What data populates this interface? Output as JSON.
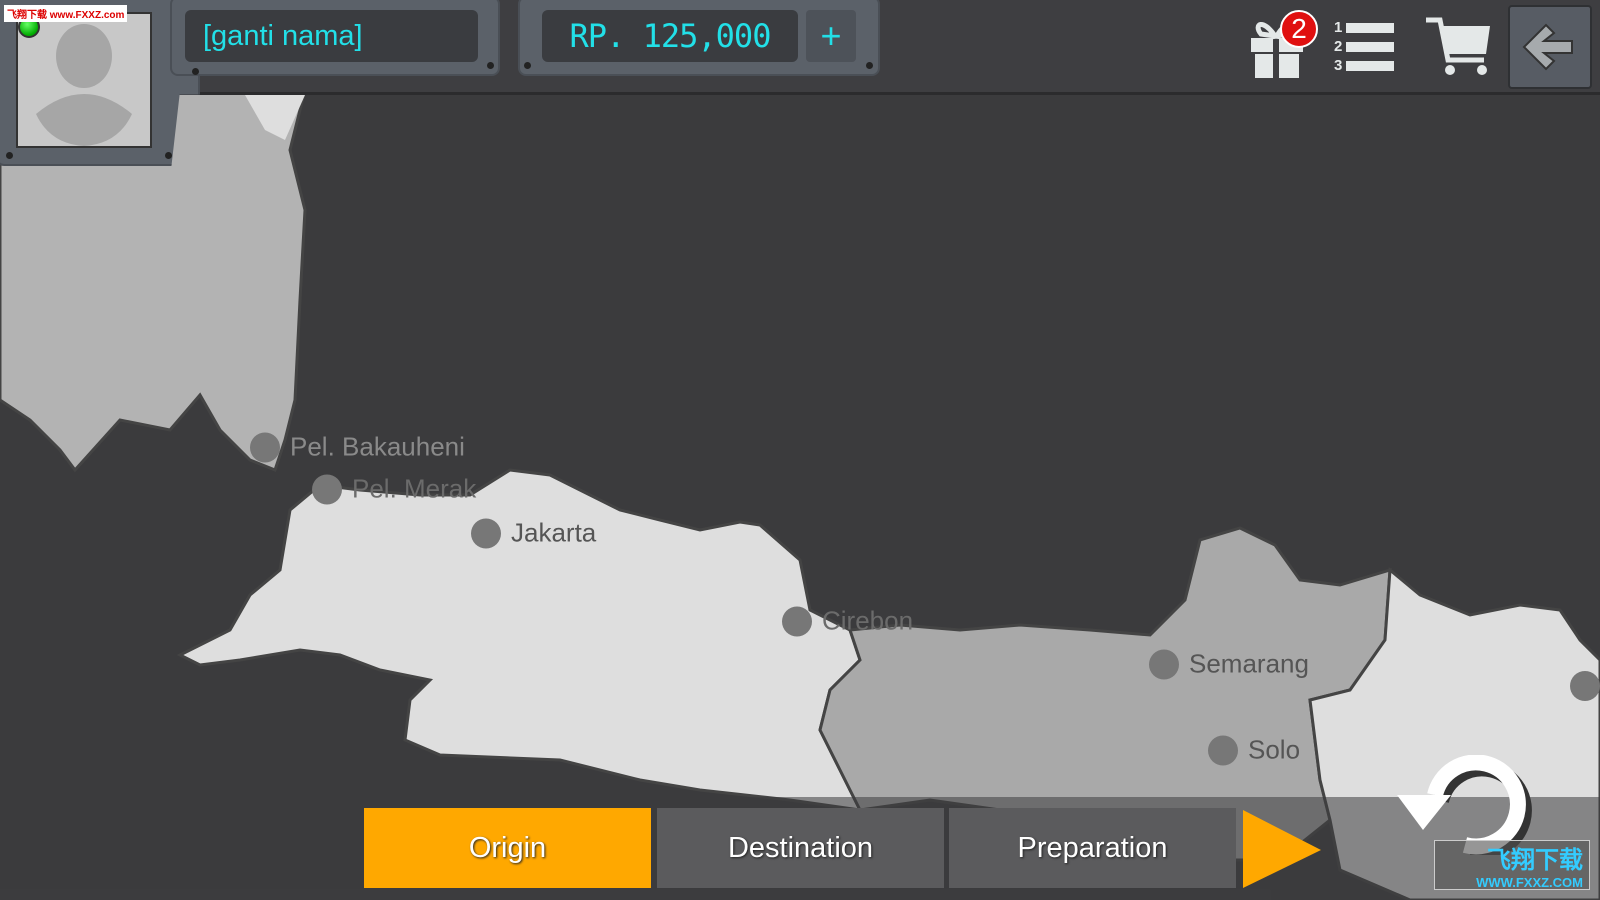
{
  "header": {
    "player_name": "[ganti nama]",
    "money": "RP. 125,000",
    "add_money_label": "+",
    "gift_badge_count": "2",
    "online_status_color": "#00cc00",
    "icons": [
      "gift-icon",
      "leaderboard-list-icon",
      "shopping-cart-icon",
      "back-arrow-icon"
    ],
    "list_numbers": [
      "1",
      "2",
      "3"
    ]
  },
  "map": {
    "cities": [
      {
        "name": "Pel. Bakauheni"
      },
      {
        "name": "Pel. Merak"
      },
      {
        "name": "Jakarta"
      },
      {
        "name": "Cirebon"
      },
      {
        "name": "Semarang"
      },
      {
        "name": "Solo"
      },
      {
        "name": ""
      }
    ]
  },
  "tabs": [
    {
      "label": "Origin",
      "active": true
    },
    {
      "label": "Destination",
      "active": false
    },
    {
      "label": "Preparation",
      "active": false
    }
  ],
  "colors": {
    "accent": "#ffa800",
    "lcd_text": "#22e0e8",
    "badge": "#e01010"
  },
  "watermarks": {
    "top_left": "飞翔下载 www.FXXZ.com",
    "bottom_right_cn": "飞翔下载",
    "bottom_right_url": "WWW.FXXZ.COM"
  }
}
